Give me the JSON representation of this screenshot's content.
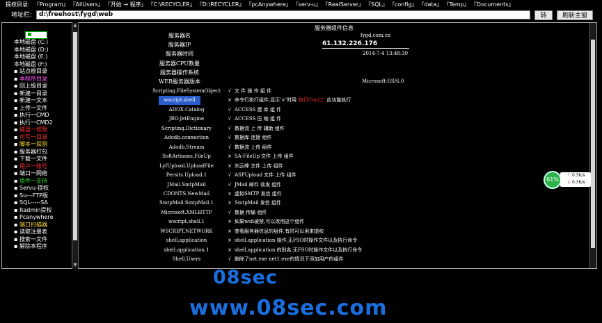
{
  "topbar": {
    "label": "提权目录:",
    "paths": [
      "『Program』",
      "『AllUsers』",
      "『开始 → 程序』",
      "『C:\\RECYCLER』",
      "『D:\\RECYCLER』",
      "『pcAnywhere』",
      "『serv-u』",
      "『RealServer』",
      "『SQL』",
      "『config』",
      "『data』",
      "『Temp』",
      "『Documents』"
    ]
  },
  "address": {
    "label": "地址栏:",
    "value": "d:\\freehost\\fygd\\web",
    "go_label": "转到",
    "refresh_label": "刷新主窗口"
  },
  "sidebar": {
    "items": [
      {
        "label": "本地磁盘 (C:)",
        "color": "#ffffff",
        "bullet": false
      },
      {
        "label": "本地磁盘 (D:)",
        "color": "#ffffff",
        "bullet": false
      },
      {
        "label": "本地磁盘 (E:)",
        "color": "#ffffff",
        "bullet": false
      },
      {
        "label": "本地磁盘 (F:)",
        "color": "#ffffff",
        "bullet": false
      },
      {
        "label": "站点根目录",
        "color": "#ffffff",
        "bullet": true
      },
      {
        "label": "本程序目录",
        "color": "#ff55ff",
        "bullet": true
      },
      {
        "label": "回上级目录",
        "color": "#ffffff",
        "bullet": true
      },
      {
        "label": "新建一目录",
        "color": "#ffffff",
        "bullet": true
      },
      {
        "label": "新建一文本",
        "color": "#ffffff",
        "bullet": true
      },
      {
        "label": "上传一文件",
        "color": "#ffffff",
        "bullet": true
      },
      {
        "label": "执行一CMD",
        "color": "#ffffff",
        "bullet": true
      },
      {
        "label": "执行一CMD2",
        "color": "#ffffff",
        "bullet": true
      },
      {
        "label": "磁盘一权限",
        "color": "#ff3333",
        "bullet": true
      },
      {
        "label": "可写一目录",
        "color": "#ff3333",
        "bullet": true
      },
      {
        "label": "脚本一探测",
        "color": "#ffdd33",
        "bullet": true
      },
      {
        "label": "服务器打包",
        "color": "#ffffff",
        "bullet": true
      },
      {
        "label": "下载一文件",
        "color": "#ffffff",
        "bullet": true
      },
      {
        "label": "用户一账号",
        "color": "#ff3333",
        "bullet": true
      },
      {
        "label": "端口一网络",
        "color": "#ffffff",
        "bullet": true
      },
      {
        "label": "组件一支持",
        "color": "#33dd33",
        "bullet": true
      },
      {
        "label": "Servu-提权",
        "color": "#ffffff",
        "bullet": true
      },
      {
        "label": "Su---FTP版",
        "color": "#ffffff",
        "bullet": true
      },
      {
        "label": "SQL-----SA",
        "color": "#ffffff",
        "bullet": true
      },
      {
        "label": "Radmin提权",
        "color": "#ffffff",
        "bullet": true
      },
      {
        "label": "Pcanywhere",
        "color": "#ffffff",
        "bullet": true
      },
      {
        "label": "端口扫描器",
        "color": "#ffdd33",
        "bullet": true
      },
      {
        "label": "读取注册表",
        "color": "#ffffff",
        "bullet": true
      },
      {
        "label": "搜索一文件",
        "color": "#ffffff",
        "bullet": true
      },
      {
        "label": "解除本程序",
        "color": "#ffffff",
        "bullet": true
      }
    ]
  },
  "main": {
    "title": "服务器组件信息",
    "server_info": [
      {
        "label": "服务器名",
        "value": "fygd.com.cn"
      },
      {
        "label": "服务器IP",
        "value": "61.132.226.176"
      },
      {
        "label": "服务器时间",
        "value": "2014-7-4 13:48:30"
      },
      {
        "label": "服务器CPU数量",
        "value": ""
      },
      {
        "label": "服务器操作系统",
        "value": ""
      },
      {
        "label": "WEB服务器版本",
        "value": "Microsoft-IIS/6.0"
      }
    ],
    "components": [
      {
        "name": "Scripting.FileSystemObject",
        "mark": "√",
        "desc": "文 件 操 作 组 件",
        "highlight": false
      },
      {
        "name": "wscript.shell",
        "mark": "×",
        "desc": "命令行执行组件,显示'×'时用",
        "desc_red": "执行Cmd二",
        "desc_tail": "此功能执行",
        "highlight": true
      },
      {
        "name": "ADOX.Catalog",
        "mark": "√",
        "desc": "ACCESS 建 库 组 件",
        "highlight": false
      },
      {
        "name": "JRO.JetEngine",
        "mark": "√",
        "desc": "ACCESS 压 缩 组 件",
        "highlight": false
      },
      {
        "name": "Scripting.Dictionary",
        "mark": "√",
        "desc": "数据流 上 传 辅助 组件",
        "highlight": false
      },
      {
        "name": "Adodb.connection",
        "mark": "√",
        "desc": "数据库 连接 组件",
        "highlight": false
      },
      {
        "name": "Adodb.Stream",
        "mark": "√",
        "desc": "数据流 上传 组件",
        "highlight": false
      },
      {
        "name": "SoftArtisans.FileUp",
        "mark": "×",
        "desc": "SA-FileUp 文件 上传 组件",
        "highlight": false
      },
      {
        "name": "LyfUpload.UploadFile",
        "mark": "×",
        "desc": "刘云峰 文件 上传 组件",
        "highlight": false
      },
      {
        "name": "Persits.Upload.1",
        "mark": "√",
        "desc": "ASPUpload 文件 上传 组件",
        "highlight": false
      },
      {
        "name": "JMail.SmtpMail",
        "mark": "√",
        "desc": "JMail 邮件 收发 组件",
        "highlight": false
      },
      {
        "name": "CDONTS.NewMail",
        "mark": "×",
        "desc": "虚拟SMTP 发信 组件",
        "highlight": false
      },
      {
        "name": "SmtpMail.SmtpMail.1",
        "mark": "×",
        "desc": "SmtpMail 发信 组件",
        "highlight": false
      },
      {
        "name": "Microsoft.XMLHTTP",
        "mark": "√",
        "desc": "数据 传输 组件",
        "highlight": false
      },
      {
        "name": "wscript.shell.1",
        "mark": "×",
        "desc": "如果wsh被禁,可以改用这个组件",
        "highlight": false
      },
      {
        "name": "WSCRIPT.NETWORK",
        "mark": "×",
        "desc": "查看服务器信息的组件,有时可以用来提权",
        "highlight": false
      },
      {
        "name": "shell.application",
        "mark": "×",
        "desc": "shell.application 操作,无FSO时操作文件以及执行命令",
        "highlight": false
      },
      {
        "name": "shell.application.1",
        "mark": "×",
        "desc": "shell.application 的别名,无FSO时操作文件以及执行命令",
        "highlight": false
      },
      {
        "name": "Shell.Users",
        "mark": "√",
        "desc": "删除了net.exe net1.exe的情况下添加用户的组件",
        "highlight": false
      }
    ]
  },
  "network": {
    "percent": "61%",
    "up": "0.3K/s",
    "down": "0.3K/s"
  },
  "watermark": {
    "line1": "08sec",
    "line2": "www.08sec.com"
  },
  "colors": {
    "highlight": "#2a5dcc",
    "watermark": "#1a6fe0",
    "red": "#ff3333"
  }
}
